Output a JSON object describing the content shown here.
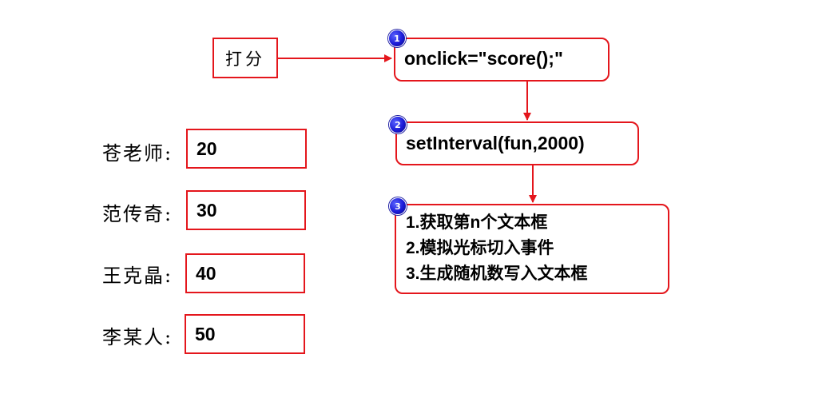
{
  "trigger": {
    "button_label": "打分"
  },
  "steps": [
    {
      "badge": "1",
      "text": "onclick=\"score();\""
    },
    {
      "badge": "2",
      "text": "setInterval(fun,2000)"
    },
    {
      "badge": "3",
      "lines": [
        "1.获取第n个文本框",
        "2.模拟光标切入事件",
        "3.生成随机数写入文本框"
      ]
    }
  ],
  "rows": [
    {
      "label": "苍老师:",
      "value": "20"
    },
    {
      "label": "范传奇:",
      "value": "30"
    },
    {
      "label": "王克晶:",
      "value": "40"
    },
    {
      "label": "李某人:",
      "value": "50"
    }
  ],
  "colors": {
    "accent": "#e4161c",
    "badge": "#1a1ad6"
  }
}
